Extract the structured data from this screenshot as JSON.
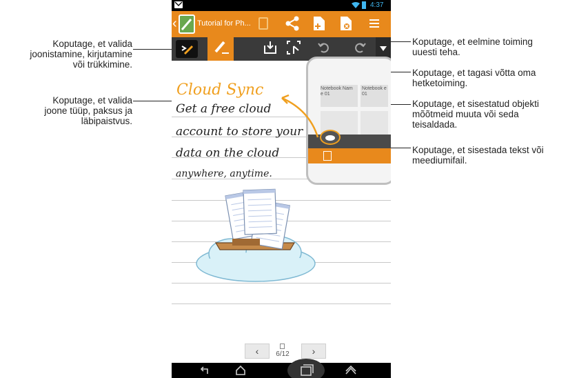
{
  "app": {
    "title": "Tutorial for Ph...",
    "status_time": "4:37",
    "statusbar_icon": "gmail-icon"
  },
  "toolbar": {
    "tools": [
      {
        "name": "pen-mode-icon"
      },
      {
        "name": "brush-icon"
      },
      {
        "name": "insert-icon"
      },
      {
        "name": "select-resize-icon"
      },
      {
        "name": "undo-icon"
      },
      {
        "name": "redo-icon"
      },
      {
        "name": "more-dropdown-icon"
      }
    ]
  },
  "note": {
    "heading": "Cloud Sync",
    "lines": [
      "Get a free cloud",
      "account to store your",
      "data on the cloud",
      "anywhere, anytime."
    ],
    "heading_color": "#f0a020"
  },
  "thumbnail": {
    "item_label_1": "Notebook Nam e 01",
    "item_label_2": "Notebook e 01"
  },
  "pager": {
    "page_indicator": "6/12",
    "prev_label": "‹",
    "next_label": "›"
  },
  "callouts": {
    "left_1": [
      "Koputage, et valida",
      "joonistamine, kirjutamine",
      "või trükkimine."
    ],
    "left_2": [
      "Koputage, et valida",
      "joone tüüp, paksus ja",
      "läbipaistvus."
    ],
    "right_1": [
      "Koputage, et eelmine toiming",
      "uuesti teha."
    ],
    "right_2": [
      "Koputage, et tagasi võtta oma",
      "hetketoiming."
    ],
    "right_3": [
      "Koputage, et sisestatud objekti",
      "mõõtmeid muuta või seda",
      "teisaldada."
    ],
    "right_4": [
      "Koputage, et sisestada tekst või",
      "meediumifail."
    ]
  },
  "colors": {
    "accent": "#e8891c",
    "toolbar_bg": "#3a3a3a",
    "callout_line": "#222222"
  }
}
